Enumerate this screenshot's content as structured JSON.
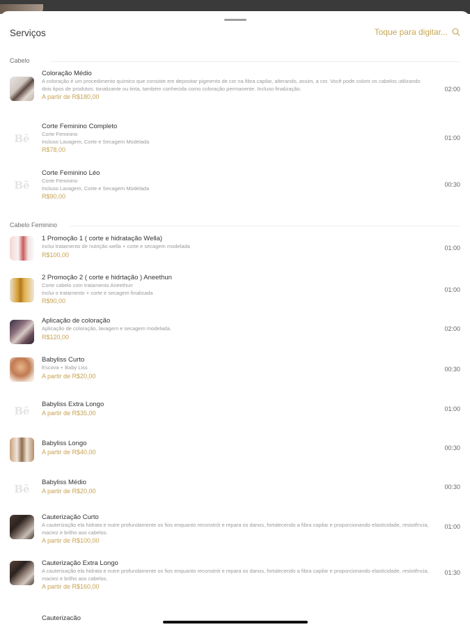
{
  "header": {
    "title": "Serviços",
    "search_placeholder": "Toque para digitar...",
    "search_icon": "search-icon"
  },
  "sections": [
    {
      "label": "Cabelo",
      "items": [
        {
          "name": "Coloração Médio",
          "desc": "A coloração é um procedimento químico que consiste em depositar pigmento de cor na fibra capilar, alterando, assim, a cor. Você pode colorir os cabelos utilizando dois tipos de produtos: tonalizante ou tinta, também conhecida como coloração permanente. Incluso finalização.",
          "price": "A partir de R$180,00",
          "time": "02:00",
          "thumb": "photo"
        },
        {
          "name": "Corte Feminino Completo",
          "desc": "Corte Feminino\nIncluso Lavagem, Corte e Secagem Modelada",
          "price": "R$78,00",
          "time": "01:00",
          "thumb": "logo"
        },
        {
          "name": "Corte Feminino Léo",
          "desc": "Corte Feminino\nIncluso Lavagem, Corte e Secagem Modelada",
          "price": "R$90,00",
          "time": "00:30",
          "thumb": "logo"
        }
      ]
    },
    {
      "label": "Cabelo Feminino",
      "items": [
        {
          "name": "1 Promoção 1 ( corte e hidratação Wella)",
          "desc": "Inclui tratamento de nutrição wella + corte e secagem modelada",
          "price": "R$100,00",
          "time": "01:00",
          "thumb": "photo"
        },
        {
          "name": "2 Promoção 2 ( corte e hidrtação ) Aneethun",
          "desc": "Corte cabelo com tratamento Aneethun\nInclui o tratamento + corte e secagem finalizada",
          "price": "R$90,00",
          "time": "01:00",
          "thumb": "photo"
        },
        {
          "name": "Aplicação de coloração",
          "desc": "Aplicação de coloração, lavagem e secagem modelada.",
          "price": "R$120,00",
          "time": "02:00",
          "thumb": "photo"
        },
        {
          "name": "Babyliss Curto",
          "desc": "Escova + Baby Liss",
          "price": "A partir de R$20,00",
          "time": "00:30",
          "thumb": "photo"
        },
        {
          "name": "Babyliss Extra Longo",
          "desc": "",
          "price": "A partir de R$35,00",
          "time": "01:00",
          "thumb": "logo"
        },
        {
          "name": "Babyliss Longo",
          "desc": "",
          "price": "A partir de R$40,00",
          "time": "00:30",
          "thumb": "photo"
        },
        {
          "name": "Babyliss Médio",
          "desc": "",
          "price": "A partir de R$20,00",
          "time": "00:30",
          "thumb": "logo"
        },
        {
          "name": "Cauterização Curto",
          "desc": "A cauterização ela hidrata e nutre profundamente os fios enquanto reconstrói e repara os danos, fortalecendo a fibra capilar e proporcionando elasticidade, resistência, maciez e brilho aos cabelos.",
          "price": "A partir de R$100,00",
          "time": "01:00",
          "thumb": "photo"
        },
        {
          "name": "Cauterização Extra Longo",
          "desc": "A cauterização ela hidrata e nutre profundamente os fios enquanto reconstrói e repara os danos, fortalecendo a fibra capilar e proporcionando elasticidade, resistência, maciez e brilho aos cabelos.",
          "price": "A partir de R$160,00",
          "time": "01:30",
          "thumb": "photo"
        }
      ]
    }
  ],
  "peek_item": "Cauterização Longo",
  "colors": {
    "accent": "#c7a252",
    "text": "#333333",
    "muted": "#9a9a9a"
  }
}
